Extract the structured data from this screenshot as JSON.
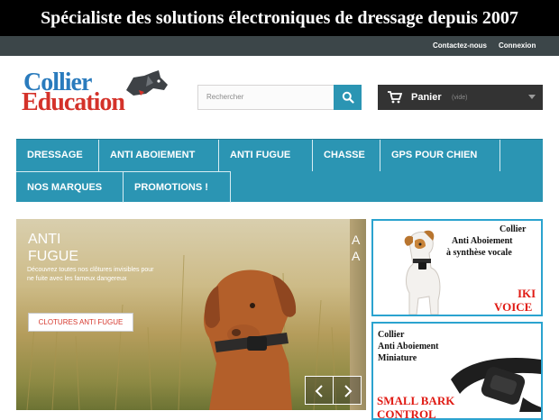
{
  "banner": {
    "text": "Spécialiste des solutions électroniques de dressage depuis 2007"
  },
  "topnav": {
    "contact": "Contactez-nous",
    "login": "Connexion"
  },
  "logo": {
    "line1": "Collier",
    "line2": "Education"
  },
  "search": {
    "placeholder": "Rechercher",
    "icon": "search-icon"
  },
  "cart": {
    "label": "Panier",
    "status": "(vide)",
    "icon": "cart-icon"
  },
  "menu": {
    "items": [
      "DRESSAGE",
      "ANTI ABOIEMENT",
      "ANTI FUGUE",
      "CHASSE",
      "GPS POUR CHIEN",
      "NOS MARQUES",
      "PROMOTIONS !"
    ]
  },
  "slider": {
    "title_line1": "ANTI",
    "title_line2": "FUGUE",
    "description": "Découvrez toutes nos clôtures invisibles pour ne fuite avec les fameux dangereux",
    "button": "CLOTURES ANTI FUGUE",
    "next_slide_peek": "A A"
  },
  "ads": [
    {
      "line1": "Collier",
      "line2": "Anti Aboiement",
      "line3": "à synthèse vocale",
      "red1": "IKI",
      "red2": "VOICE"
    },
    {
      "line1": "Collier",
      "line2": "Anti Aboiement",
      "line3": "Miniature",
      "red1": "SMALL BARK",
      "red2": "CONTROL"
    }
  ],
  "colors": {
    "accent": "#2b95b3",
    "banner_bg": "#000000",
    "topnav_bg": "#3c4649",
    "cart_bg": "#333333",
    "logo_blue": "#2a7bbd",
    "logo_red": "#d4322a",
    "ad_red": "#e01b14"
  }
}
